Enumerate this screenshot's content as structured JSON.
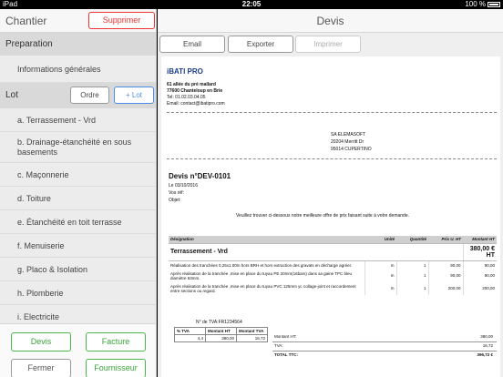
{
  "status": {
    "carrier": "iPad",
    "time": "22:05",
    "battery": "100 %"
  },
  "left": {
    "title": "Chantier",
    "delete_label": "Supprimer",
    "section_preparation": "Preparation",
    "info_label": "Informations générales",
    "lot_label": "Lot",
    "ordre_label": "Ordre",
    "add_lot_label": "+ Lot",
    "lots": [
      "a. Terrassement - Vrd",
      "b. Drainage-étanchéité en sous basements",
      "c. Maçonnerie",
      "d. Toiture",
      "e. Étanchéité en toit terrasse",
      "f. Menuiserie",
      "g. Placo & Isolation",
      "h. Plomberie",
      "i. Electricite"
    ],
    "footer": {
      "devis": "Devis",
      "facture": "Facture",
      "fermer": "Fermer",
      "fournisseur": "Fournisseur"
    }
  },
  "right": {
    "title": "Devis",
    "email_label": "Email",
    "exporter_label": "Exporter",
    "imprimer_label": "Imprimer"
  },
  "doc": {
    "company": {
      "name": "iBATI PRO",
      "address1": "61 allée du pré mallard",
      "address2": "77600 Chanteloup en Brie",
      "tel": "Tel: 01.02.03.04.05",
      "email": "Email: contact@ibatipro.com"
    },
    "client": {
      "name": "SA ELEMASOFT",
      "address": "20204 Merritt Dr",
      "city": "95014 CUPERTINO"
    },
    "devis_number": "Devis n°DEV-0101",
    "date": "Le 03/10/2016",
    "vos_ref": "Vos réf:",
    "objet": "Objet:",
    "intro": "Veuillez trouver ci-dessous notre meilleure offre de prix faisant suite à votre demande.",
    "table_headers": [
      "Désignation",
      "Unité",
      "Quantité",
      "Prix U. HT",
      "Montant HT"
    ],
    "section": {
      "title": "Terrassement - Vrd",
      "total": "380,00 € HT"
    },
    "rows": [
      {
        "des": "Réalisation des tranchées 0,25x1.00m hors BRH et hors extraction des gravats en décharge agréer.",
        "unit": "m",
        "qty": "1",
        "pu": "90,00",
        "total": "90,00"
      },
      {
        "des": "Après réalisation de la tranchée ,mise en place du tuyau PE 20mm(16bars) dans sa gaine TPC bleu diamètre 63mm.",
        "unit": "m",
        "qty": "1",
        "pu": "90,00",
        "total": "90,00"
      },
      {
        "des": "Après réalisation de la tranchée ,mise en place du tuyau PVC 125mm yc collage-joint et raccordement entre sections ou regard.",
        "unit": "m",
        "qty": "1",
        "pu": "200,00",
        "total": "200,00"
      }
    ],
    "tva_number": "N° de TVA:FR1234564",
    "tva_headers": [
      "% TVA",
      "Montant HT",
      "Montant TVA"
    ],
    "tva_row": [
      "4,4",
      "380,00",
      "16,72"
    ],
    "totals": {
      "montant_ht_label": "Montant HT:",
      "montant_ht": "380,00",
      "tva_label": "TVA:",
      "tva": "16,72",
      "ttc_label": "TOTAL TTC:",
      "ttc": "396,72 €"
    }
  }
}
